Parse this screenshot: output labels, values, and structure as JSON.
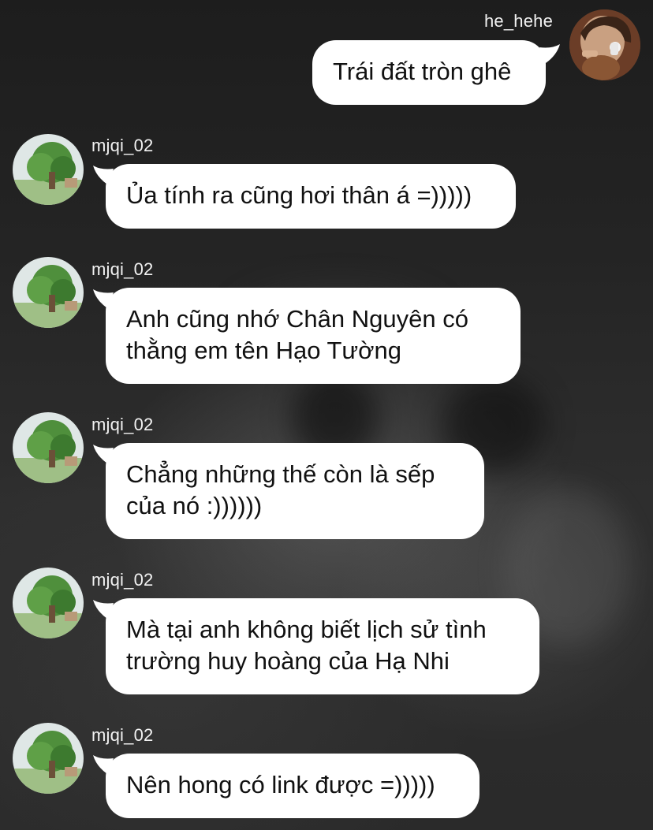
{
  "conversation": {
    "sent": {
      "sender": "he_hehe",
      "text": "Trái đất tròn ghê"
    },
    "received": [
      {
        "sender": "mjqi_02",
        "text": "Ủa tính ra cũng hơi thân á =)))))"
      },
      {
        "sender": "mjqi_02",
        "line1": "Anh cũng nhớ Chân Nguyên có",
        "line2": "thằng em tên Hạo Tường"
      },
      {
        "sender": "mjqi_02",
        "line1": "Chẳng những thế còn là sếp",
        "line2": "của nó :))))))"
      },
      {
        "sender": "mjqi_02",
        "line1": "Mà tại anh không biết lịch sử tình",
        "line2": "trường huy hoàng của Hạ Nhi"
      },
      {
        "sender": "mjqi_02",
        "text": "Nên hong có link được =)))))"
      }
    ]
  },
  "colors": {
    "bubble": "#ffffff",
    "text": "#111111",
    "username": "#f2f2f2",
    "background": "#2a2a2a"
  },
  "icons": {
    "sent_avatar": "person-photo-avatar",
    "received_avatar": "tree-avatar"
  }
}
